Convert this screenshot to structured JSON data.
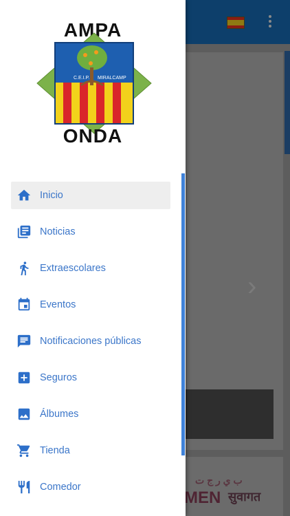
{
  "colors": {
    "accent": "#3f82d9",
    "menu_text": "#3b76c9",
    "app_bar": "#0d3f6b"
  },
  "drawer": {
    "logo": {
      "top_text": "AMPA",
      "bottom_text": "ONDA",
      "school_text": "C.E.I.P. MIRALCAMP"
    },
    "items": [
      {
        "label": "Inicio",
        "icon": "home-icon",
        "active": true
      },
      {
        "label": "Noticias",
        "icon": "news-icon"
      },
      {
        "label": "Extraescolares",
        "icon": "running-icon"
      },
      {
        "label": "Eventos",
        "icon": "calendar-icon"
      },
      {
        "label": "Notificaciones públicas",
        "icon": "message-icon"
      },
      {
        "label": "Seguros",
        "icon": "plus-box-icon"
      },
      {
        "label": "Álbumes",
        "icon": "image-icon"
      },
      {
        "label": "Tienda",
        "icon": "cart-icon"
      },
      {
        "label": "Comedor",
        "icon": "cutlery-icon"
      }
    ]
  },
  "background": {
    "language_flag": "flag-es-icon",
    "overflow_menu": "more-vert-icon"
  }
}
